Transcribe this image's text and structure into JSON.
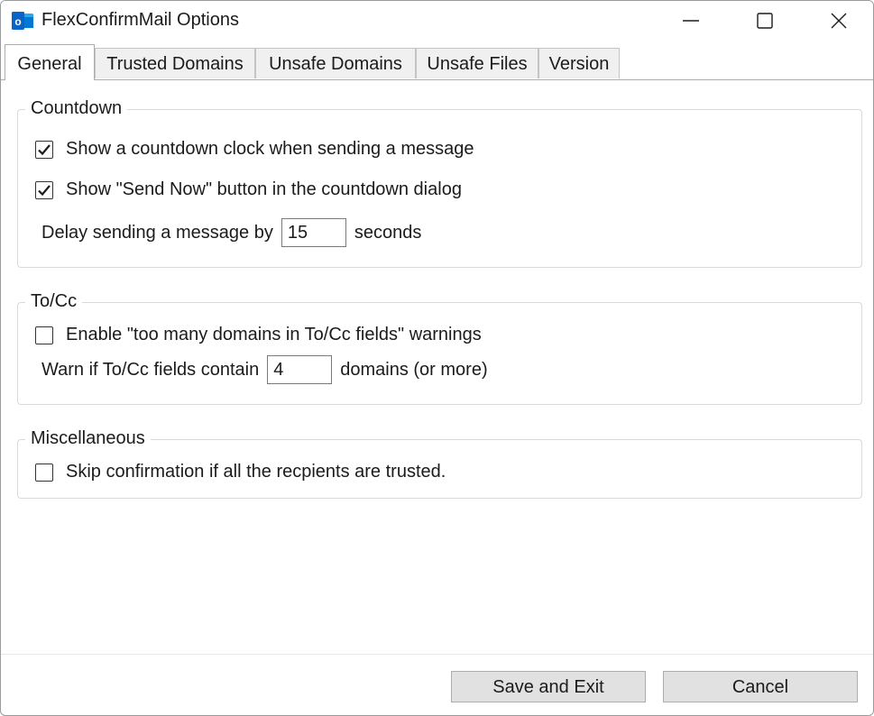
{
  "window": {
    "title": "FlexConfirmMail Options"
  },
  "icons": {
    "app": "outlook-icon",
    "minimize": "minimize-icon",
    "maximize": "maximize-icon",
    "close": "close-icon",
    "check": "checkmark-icon"
  },
  "colors": {
    "outlook_blue": "#0a64c8",
    "checkmark": "#1b1b1b",
    "tab_inactive": "#f0f0f0"
  },
  "tabs": [
    {
      "label": "General",
      "active": true
    },
    {
      "label": "Trusted Domains",
      "active": false
    },
    {
      "label": "Unsafe Domains",
      "active": false
    },
    {
      "label": "Unsafe Files",
      "active": false
    },
    {
      "label": "Version",
      "active": false
    }
  ],
  "countdown": {
    "title": "Countdown",
    "show_clock": {
      "label": "Show a countdown clock when sending a message",
      "checked": true
    },
    "show_send_now": {
      "label": "Show \"Send Now\" button in the countdown dialog",
      "checked": true
    },
    "delay_prefix": "Delay sending a message by",
    "delay_value": "15",
    "delay_suffix": "seconds"
  },
  "tocc": {
    "title": "To/Cc",
    "enable_warning": {
      "label": "Enable \"too many domains in To/Cc fields\" warnings",
      "checked": false
    },
    "warn_prefix": "Warn if To/Cc fields contain",
    "warn_value": "4",
    "warn_suffix": "domains (or more)"
  },
  "misc": {
    "title": "Miscellaneous",
    "skip_confirmation": {
      "label": "Skip confirmation if all the recpients are trusted.",
      "checked": false
    }
  },
  "buttons": {
    "save": "Save and Exit",
    "cancel": "Cancel"
  }
}
